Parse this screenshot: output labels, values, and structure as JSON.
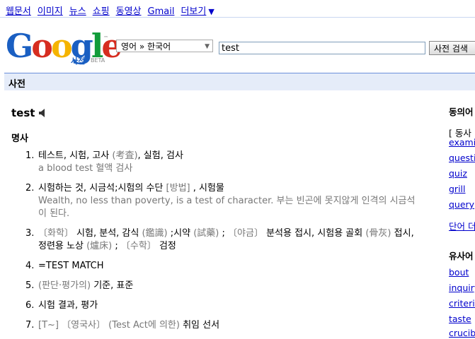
{
  "nav": {
    "links": [
      "웹문서",
      "이미지",
      "뉴스",
      "쇼핑",
      "동영상",
      "Gmail",
      "더보기"
    ],
    "more_caret": "▼"
  },
  "logo": {
    "text": "Google",
    "sub": "사전",
    "beta": "BETA",
    "tm": "™"
  },
  "search": {
    "lang_select": "영어 » 한국어",
    "query": "test",
    "button": "사전 검색"
  },
  "section_title": "사전",
  "entry": {
    "headword": "test",
    "part_of_speech": "명사",
    "definitions": [
      {
        "num": "1.",
        "lines": [
          {
            "text": "테스트, 시험, 고사 ",
            "gray": false
          },
          {
            "text": "(考査)",
            "gray": true
          },
          {
            "text": ", 실험, 검사",
            "gray": false
          }
        ],
        "example": "a blood test 혈액 검사"
      },
      {
        "num": "2.",
        "lines": [
          {
            "text": "시험하는 것, 시금석;시험의 수단 ",
            "gray": false
          },
          {
            "text": "[방법]",
            "gray": true
          },
          {
            "text": " , 시험물",
            "gray": false
          }
        ],
        "example": "Wealth, no less than poverty, is a test of character. 부는 빈곤에 못지않게 인격의 시금석이 된다."
      },
      {
        "num": "3.",
        "lines": [
          {
            "text": "〔화학〕",
            "gray": true
          },
          {
            "text": " 시험, 분석, 감식 ",
            "gray": false
          },
          {
            "text": "(鑑識)",
            "gray": true
          },
          {
            "text": " ;시약 ",
            "gray": false
          },
          {
            "text": "(試藥)",
            "gray": true
          },
          {
            "text": " ; ",
            "gray": false
          },
          {
            "text": "〔야금〕",
            "gray": true
          },
          {
            "text": " 분석용 접시, 시험용 골회 ",
            "gray": false
          },
          {
            "text": "(骨灰)",
            "gray": true
          },
          {
            "text": " 접시, 정련용 노상 ",
            "gray": false
          },
          {
            "text": "(爐床)",
            "gray": true
          },
          {
            "text": " ; ",
            "gray": false
          },
          {
            "text": "〔수학〕",
            "gray": true
          },
          {
            "text": " 검정",
            "gray": false
          }
        ],
        "example": ""
      },
      {
        "num": "4.",
        "lines": [
          {
            "text": "=TEST MATCH",
            "gray": false
          }
        ],
        "example": ""
      },
      {
        "num": "5.",
        "lines": [
          {
            "text": "(판단·평가의)",
            "gray": true
          },
          {
            "text": " 기준, 표준",
            "gray": false
          }
        ],
        "example": ""
      },
      {
        "num": "6.",
        "lines": [
          {
            "text": "시험 결과, 평가",
            "gray": false
          }
        ],
        "example": ""
      },
      {
        "num": "7.",
        "lines": [
          {
            "text": "[T~]",
            "gray": true
          },
          {
            "text": " ",
            "gray": false
          },
          {
            "text": "〔영국사〕",
            "gray": true
          },
          {
            "text": " ",
            "gray": false
          },
          {
            "text": "(Test Act에 의한)",
            "gray": true
          },
          {
            "text": " 취임 선서",
            "gray": false
          }
        ],
        "example": ""
      }
    ]
  },
  "sidebar": {
    "synonyms_title": "동의어",
    "synonyms_label": "[ 동사 ]",
    "synonyms": [
      "examine",
      "question",
      "quiz",
      "grill",
      "query"
    ],
    "more_words": "단어 더보기",
    "similar_title": "유사어",
    "similar": [
      "bout",
      "inquiry",
      "criterion",
      "taste",
      "crucible"
    ]
  },
  "colors": {
    "link": "#0000cc",
    "section_bg": "#e5ecf9",
    "section_border": "#6b90da",
    "gray_text": "#777777"
  }
}
